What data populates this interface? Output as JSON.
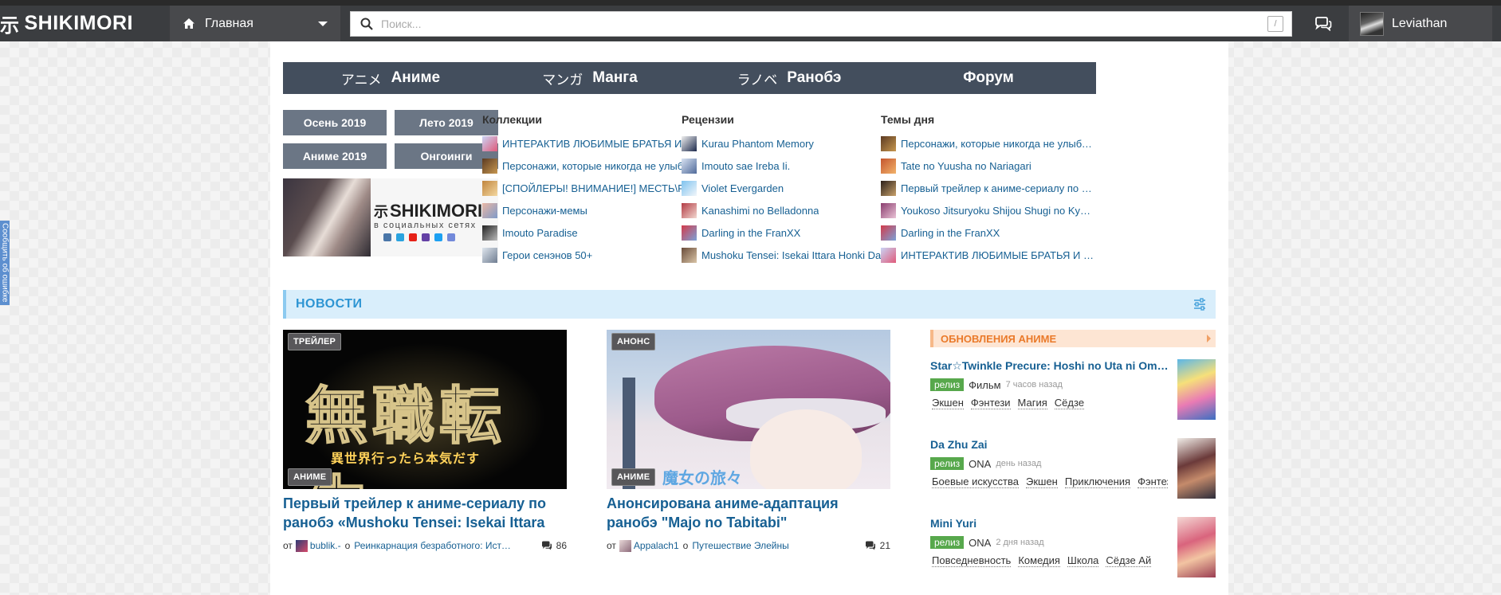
{
  "header": {
    "logo_text": "SHIKIMORI",
    "logo_glyph": "示",
    "nav_main_label": "Главная",
    "search_placeholder": "Поиск...",
    "search_shortcut": "/",
    "user_name": "Leviathan"
  },
  "side_tab": {
    "label": "Сообщить об ошибке"
  },
  "columns": {
    "anime": {
      "jp": "アニメ",
      "title": "Аниме",
      "quick": [
        "Осень 2019",
        "Лето 2019",
        "Аниме 2019",
        "Онгоинги"
      ],
      "banner": {
        "logo": "SHIKIMORI",
        "glyph": "示",
        "sub": "в социальных сетях"
      }
    },
    "manga": {
      "jp": "マンガ",
      "title": "Манга",
      "list_title": "Коллекции",
      "items": [
        "ИНТЕРАКТИВ ЛЮБИМЫЕ БРАТЬЯ И СЕСТРЫ",
        "Персонажи, которые никогда не улыбаются",
        "[СПОЙЛЕРЫ! ВНИМАНИЕ!] МЕСТЬ\\РЕВАНШ",
        "Персонажи-мемы",
        "Imouto Paradise",
        "Герои сенэнов 50+"
      ]
    },
    "ranobe": {
      "jp": "ラノベ",
      "title": "Ранобэ",
      "list_title": "Рецензии",
      "items": [
        "Kurau Phantom Memory",
        "Imouto sae Ireba Ii.",
        "Violet Evergarden",
        "Kanashimi no Belladonna",
        "Darling in the FranXX",
        "Mushoku Tensei: Isekai Ittara Honki Dasu"
      ]
    },
    "forum": {
      "title": "Форум",
      "list_title": "Темы дня",
      "items": [
        "Персонажи, которые никогда не улыбаются",
        "Tate no Yuusha no Nariagari",
        "Первый трейлер к аниме-сериалу по ранобэ",
        "Youkoso Jitsuryoku Shijou Shugi no Kyoushitsu e",
        "Darling in the FranXX",
        "ИНТЕРАКТИВ ЛЮБИМЫЕ БРАТЬЯ И СЕСТРЫ"
      ]
    }
  },
  "news": {
    "section_title": "НОВОСТИ",
    "items": [
      {
        "badge_top": "ТРЕЙЛЕР",
        "badge_bottom": "АНИМЕ",
        "image_kanji": "無職転生",
        "image_sub": "異世界行ったら本気だす",
        "title": "Первый трейлер к аниме-сериалу по ранобэ «Mushoku Tensei: Isekai Ittara Honki Dasu»",
        "by": "от",
        "author": "bublik.-",
        "about": "о",
        "topic": "Реинкарнация безработного: История о приключениях в другом мире",
        "comments": "86"
      },
      {
        "badge_top": "АНОНС",
        "badge_bottom": "АНИМЕ",
        "image_sub": "魔女の旅々",
        "title": "Анонсирована аниме-адаптация ранобэ \"Majo no Tabitabi\"",
        "by": "от",
        "author": "Appalach1",
        "about": "о",
        "topic": "Путешествие Элейны",
        "comments": "21"
      }
    ]
  },
  "updates": {
    "title": "ОБНОВЛЕНИЯ АНИМЕ",
    "items": [
      {
        "title": "Star☆Twinkle Precure: Hoshi no Uta ni Omoi wo Komete",
        "status": "релиз",
        "kind": "Фильм",
        "time": "7 часов назад",
        "genres": [
          "Экшен",
          "Фэнтези",
          "Магия",
          "Сёдзе"
        ]
      },
      {
        "title": "Da Zhu Zai",
        "status": "релиз",
        "kind": "ONA",
        "time": "день назад",
        "genres": [
          "Боевые искусства",
          "Экшен",
          "Приключения",
          "Фэнтези"
        ]
      },
      {
        "title": "Mini Yuri",
        "status": "релиз",
        "kind": "ONA",
        "time": "2 дня назад",
        "genres": [
          "Повседневность",
          "Комедия",
          "Школа",
          "Сёдзе Ай"
        ]
      }
    ]
  },
  "colors": {
    "topbar": "#3b3d40",
    "column_header": "#434e5d",
    "link": "#176093",
    "news_accent": "#2d95d3",
    "updates_accent": "#ea7a2a",
    "release_badge": "#57a84c"
  }
}
